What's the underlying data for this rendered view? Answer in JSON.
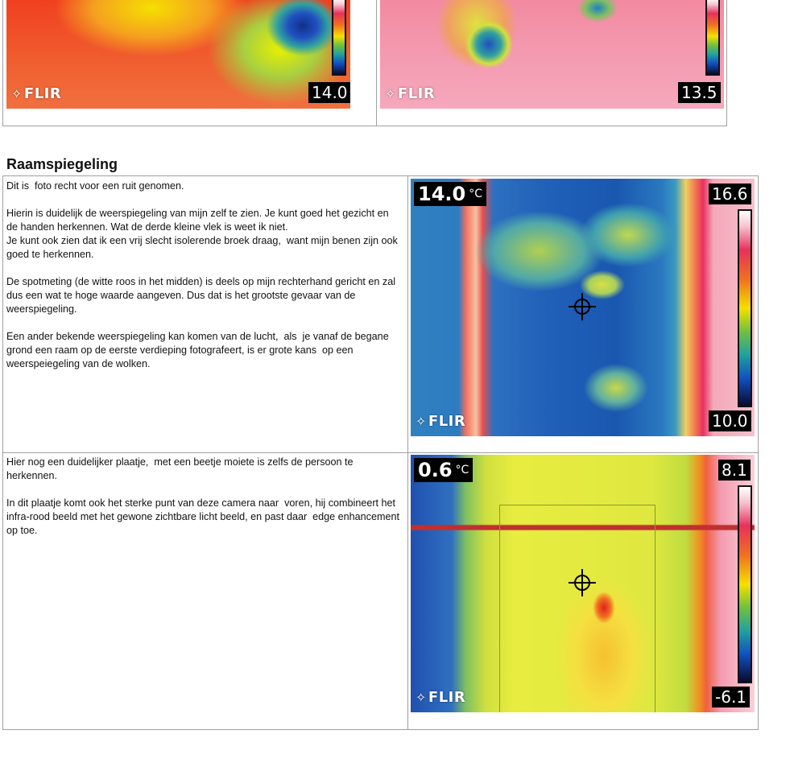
{
  "top_images": {
    "left_value": "14.0",
    "right_value": "13.5"
  },
  "logo_text": "FLIR",
  "section_title": "Raamspiegeling",
  "rows": [
    {
      "text": "Dit is  foto recht voor een ruit genomen.\n\nHierin is duidelijk de weerspiegeling van mijn zelf te zien. Je kunt goed het gezicht en de handen herkennen. Wat de derde kleine vlek is weet ik niet.\nJe kunt ook zien dat ik een vrij slecht isolerende broek draag,  want mijn benen zijn ook goed te herkennen.\n\nDe spotmeting (de witte roos in het midden) is deels op mijn rechterhand gericht en zal  dus een wat te hoge waarde aangeven. Dus dat is het grootste gevaar van de weerspiegeling.\n\nEen ander bekende weerspiegeling kan komen van de lucht,  als  je vanaf de begane grond een raam op de eerste verdieping fotografeert, is er grote kans  op een weerspeiegeling van de wolken.",
      "spot_value": "14.0",
      "unit": "°C",
      "scale_max": "16.6",
      "scale_min": "10.0"
    },
    {
      "text": "Hier nog een duidelijker plaatje,  met een beetje moiete is zelfs de persoon te herkennen.\n\nIn dit plaatje komt ook het sterke punt van deze camera naar  voren, hij combineert het infra-rood beeld met het gewone zichtbare licht beeld, en past daar  edge enhancement op toe.",
      "spot_value": "0.6",
      "unit": "°C",
      "scale_max": "8.1",
      "scale_min": "-6.1"
    }
  ],
  "colors": {
    "border": "#a0a0a0",
    "thermal_red": "#e8305a",
    "thermal_yellow": "#f5e000",
    "thermal_blue": "#1050c0"
  }
}
